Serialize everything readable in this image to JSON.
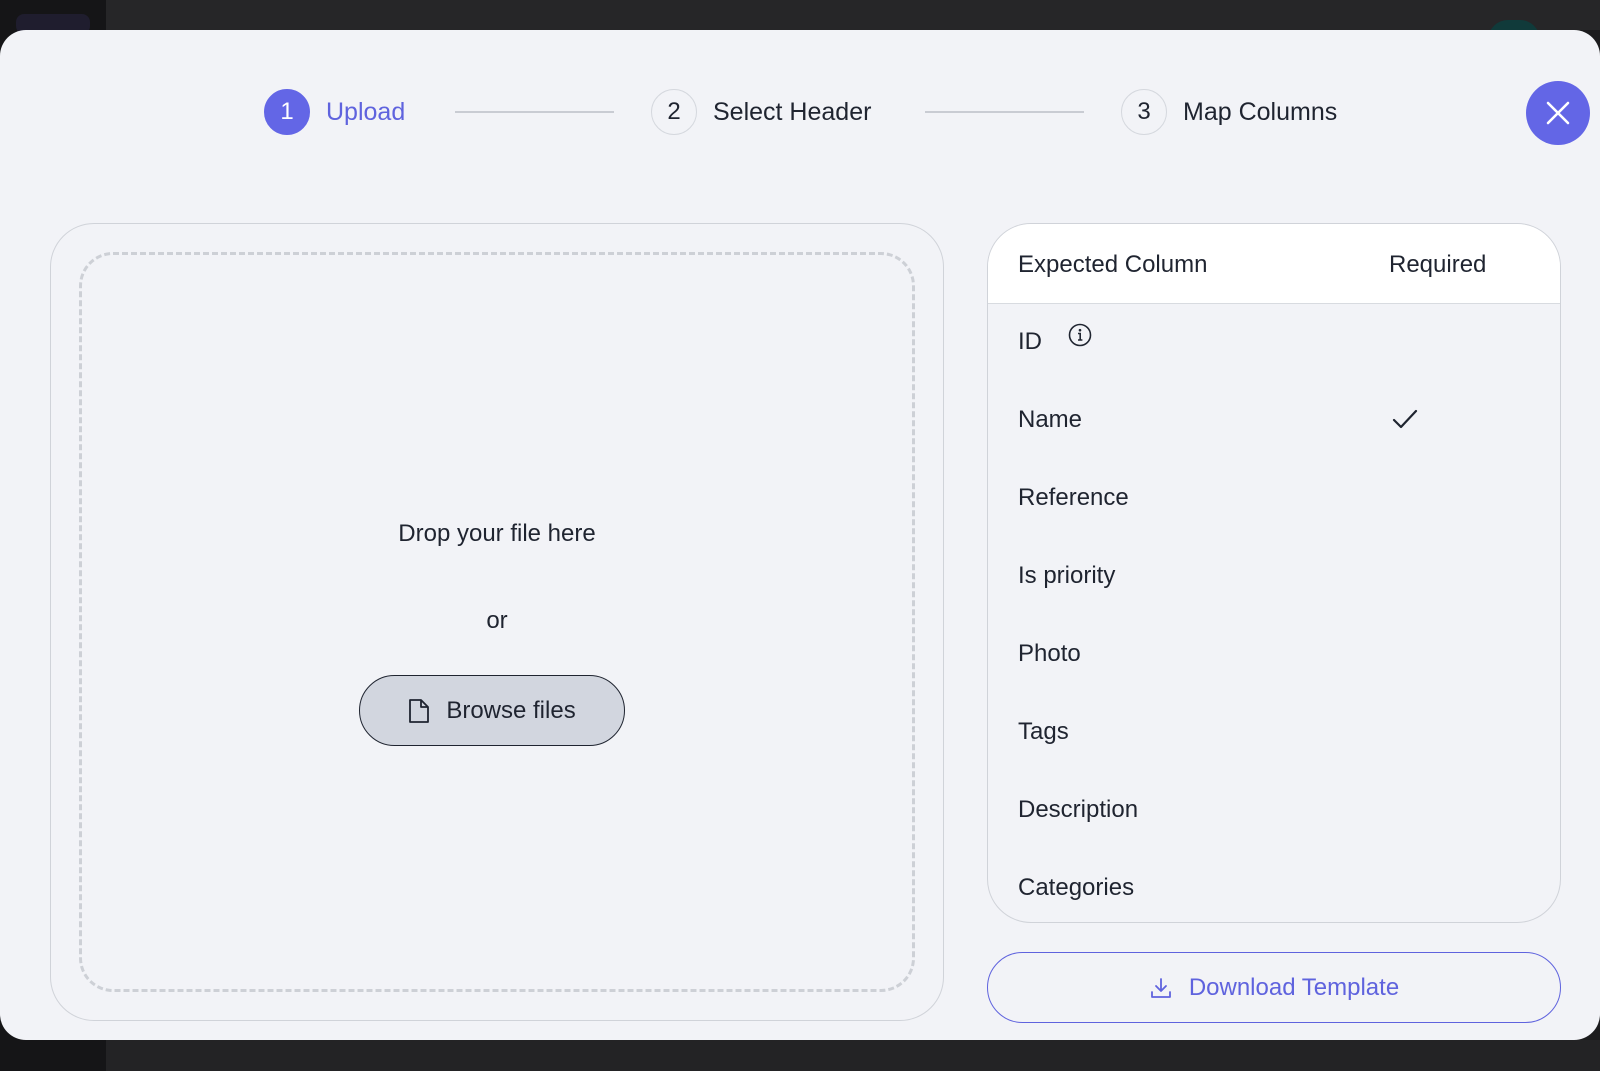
{
  "stepper": {
    "steps": [
      {
        "number": "1",
        "label": "Upload",
        "active": true
      },
      {
        "number": "2",
        "label": "Select Header",
        "active": false
      },
      {
        "number": "3",
        "label": "Map Columns",
        "active": false
      }
    ]
  },
  "dropzone": {
    "primary_text": "Drop your file here",
    "or_text": "or",
    "browse_label": "Browse files"
  },
  "columns_table": {
    "headers": {
      "expected": "Expected Column",
      "required": "Required"
    },
    "rows": [
      {
        "name": "ID",
        "required": false,
        "info": true
      },
      {
        "name": "Name",
        "required": true,
        "info": false
      },
      {
        "name": "Reference",
        "required": false,
        "info": false
      },
      {
        "name": "Is priority",
        "required": false,
        "info": false
      },
      {
        "name": "Photo",
        "required": false,
        "info": false
      },
      {
        "name": "Tags",
        "required": false,
        "info": false
      },
      {
        "name": "Description",
        "required": false,
        "info": false
      },
      {
        "name": "Categories",
        "required": false,
        "info": false
      }
    ]
  },
  "download_template_label": "Download Template",
  "icons": {
    "close": "close-icon",
    "file": "file-icon",
    "info": "info-icon",
    "check": "check-icon",
    "download": "download-icon"
  },
  "colors": {
    "accent": "#6366e6",
    "modal_background": "#f2f3f7",
    "text": "#1f2430"
  }
}
